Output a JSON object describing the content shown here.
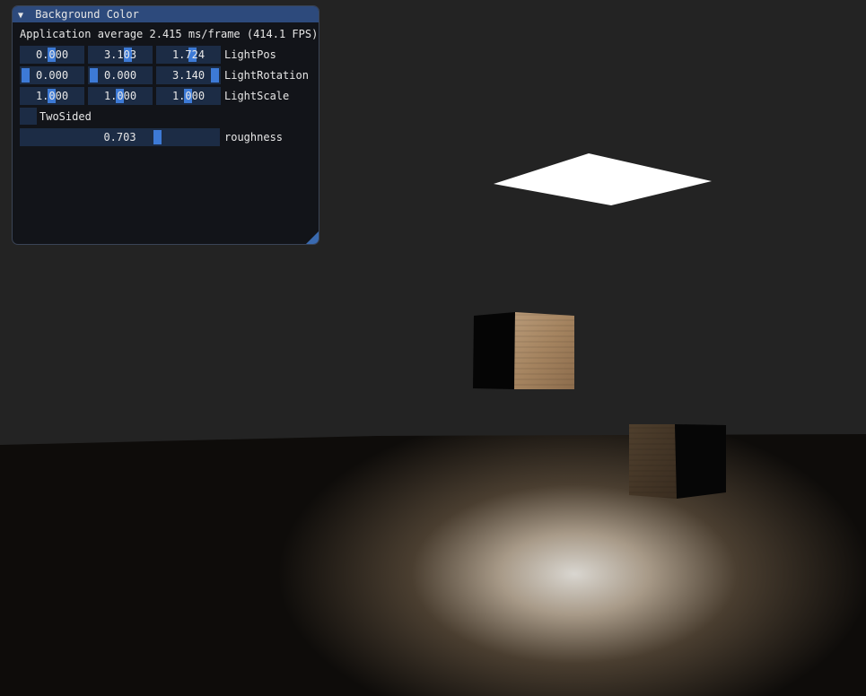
{
  "window": {
    "title": "Background Color",
    "collapse_icon": "triangle-down-icon",
    "stats": "Application average 2.415 ms/frame (414.1 FPS)",
    "light_pos": {
      "label": "LightPos",
      "values": [
        "0.000",
        "3.103",
        "1.724"
      ],
      "grab_fraction": [
        0.5,
        0.6,
        0.52
      ]
    },
    "light_rotation": {
      "label": "LightRotation",
      "values": [
        "0.000",
        "0.000",
        "3.140"
      ],
      "grab_fraction": [
        0.0,
        0.0,
        1.0
      ]
    },
    "light_scale": {
      "label": "LightScale",
      "values": [
        "1.000",
        "1.000",
        "1.000"
      ],
      "grab_fraction": [
        0.5,
        0.5,
        0.5
      ]
    },
    "two_sided": {
      "label": "TwoSided",
      "checked": false
    },
    "roughness": {
      "label": "roughness",
      "value": "0.703",
      "fraction": 0.703
    }
  },
  "colors": {
    "title_bar": "#2d4a7c",
    "frame_bg": "#1c2c45",
    "grab": "#3d7ad6",
    "scene_wall": "#232323"
  }
}
